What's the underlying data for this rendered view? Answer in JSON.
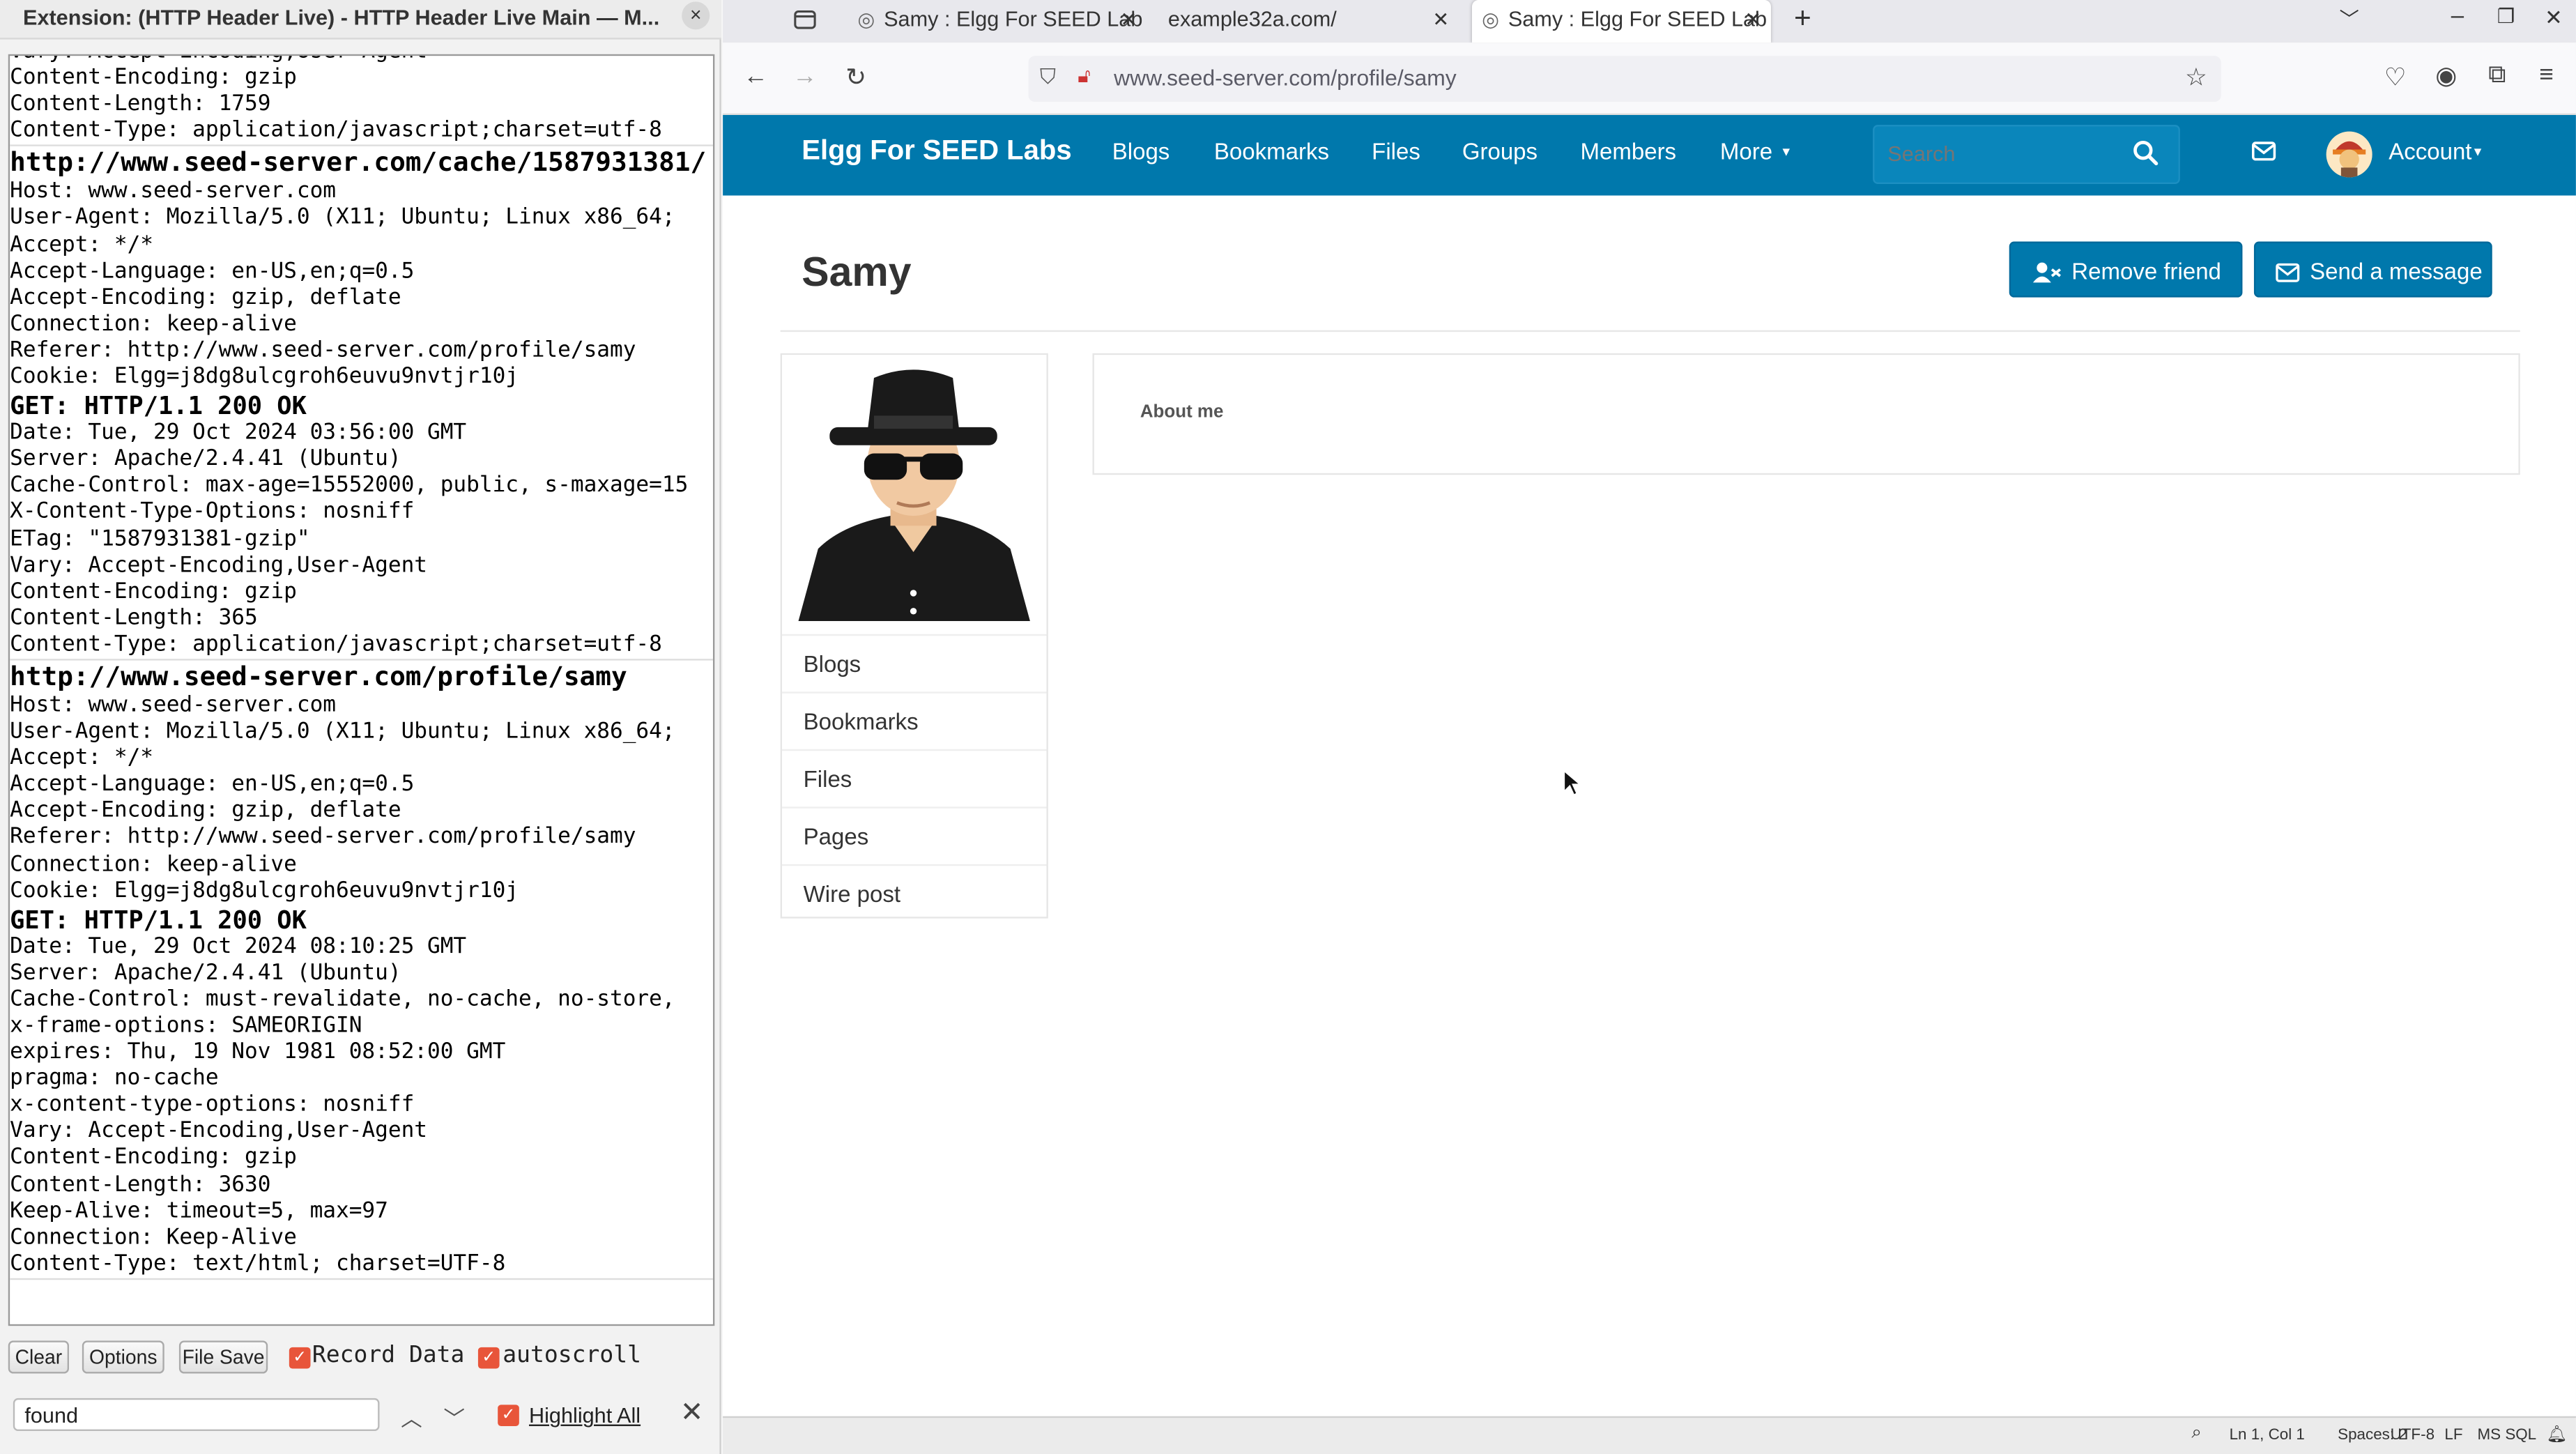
{
  "extension": {
    "title": "Extension: (HTTP Header Live) - HTTP Header Live Main — M...",
    "close_glyph": "×",
    "entries": [
      {
        "url": "",
        "lines": [
          "Vary: Accept-Encoding,User-Agent",
          "Content-Encoding: gzip",
          "Content-Length: 1759",
          "Content-Type: application/javascript;charset=utf-8"
        ],
        "status": "",
        "response": []
      },
      {
        "url": "http://www.seed-server.com/cache/1587931381/",
        "lines": [
          "Host: www.seed-server.com",
          "User-Agent: Mozilla/5.0 (X11; Ubuntu; Linux x86_64;",
          "Accept: */*",
          "Accept-Language: en-US,en;q=0.5",
          "Accept-Encoding: gzip, deflate",
          "Connection: keep-alive",
          "Referer: http://www.seed-server.com/profile/samy",
          "Cookie: Elgg=j8dg8ulcgroh6euvu9nvtjr10j"
        ],
        "status": "GET: HTTP/1.1 200 OK",
        "response": [
          "Date: Tue, 29 Oct 2024 03:56:00 GMT",
          "Server: Apache/2.4.41 (Ubuntu)",
          "Cache-Control: max-age=15552000, public, s-maxage=15",
          "X-Content-Type-Options: nosniff",
          "ETag: \"1587931381-gzip\"",
          "Vary: Accept-Encoding,User-Agent",
          "Content-Encoding: gzip",
          "Content-Length: 365",
          "Content-Type: application/javascript;charset=utf-8"
        ]
      },
      {
        "url": "http://www.seed-server.com/profile/samy",
        "lines": [
          "Host: www.seed-server.com",
          "User-Agent: Mozilla/5.0 (X11; Ubuntu; Linux x86_64;",
          "Accept: */*",
          "Accept-Language: en-US,en;q=0.5",
          "Accept-Encoding: gzip, deflate",
          "Referer: http://www.seed-server.com/profile/samy",
          "Connection: keep-alive",
          "Cookie: Elgg=j8dg8ulcgroh6euvu9nvtjr10j"
        ],
        "status": "GET: HTTP/1.1 200 OK",
        "response": [
          "Date: Tue, 29 Oct 2024 08:10:25 GMT",
          "Server: Apache/2.4.41 (Ubuntu)",
          "Cache-Control: must-revalidate, no-cache, no-store,",
          "x-frame-options: SAMEORIGIN",
          "expires: Thu, 19 Nov 1981 08:52:00 GMT",
          "pragma: no-cache",
          "x-content-type-options: nosniff",
          "Vary: Accept-Encoding,User-Agent",
          "Content-Encoding: gzip",
          "Content-Length: 3630",
          "Keep-Alive: timeout=5, max=97",
          "Connection: Keep-Alive",
          "Content-Type: text/html; charset=UTF-8"
        ]
      }
    ],
    "buttons": {
      "clear": "Clear",
      "options": "Options",
      "file_save": "File Save"
    },
    "checkboxes": {
      "record": "Record Data",
      "autoscroll": "autoscroll"
    },
    "find": {
      "value": "found",
      "highlight_all": "Highlight All"
    }
  },
  "browser": {
    "tabs": [
      {
        "label": "Samy : Elgg For SEED Lab"
      },
      {
        "label": "example32a.com/"
      },
      {
        "label": "Samy : Elgg For SEED Lab"
      }
    ],
    "url": "www.seed-server.com/profile/samy"
  },
  "site": {
    "title": "Elgg For SEED Labs",
    "nav": [
      "Blogs",
      "Bookmarks",
      "Files",
      "Groups",
      "Members",
      "More"
    ],
    "search_placeholder": "Search",
    "account": "Account"
  },
  "profile": {
    "name": "Samy",
    "remove_friend": "Remove friend",
    "send_message": "Send a message",
    "menu": [
      "Blogs",
      "Bookmarks",
      "Files",
      "Pages",
      "Wire post"
    ],
    "about_me": "About me"
  },
  "statusbar": {
    "position": "Ln 1, Col 1",
    "spaces": "Spaces: 2",
    "encoding": "UTF-8",
    "eol": "LF",
    "language": "MS SQL"
  },
  "colors": {
    "accent": "#0078ac",
    "checkbox": "#e8553a"
  }
}
